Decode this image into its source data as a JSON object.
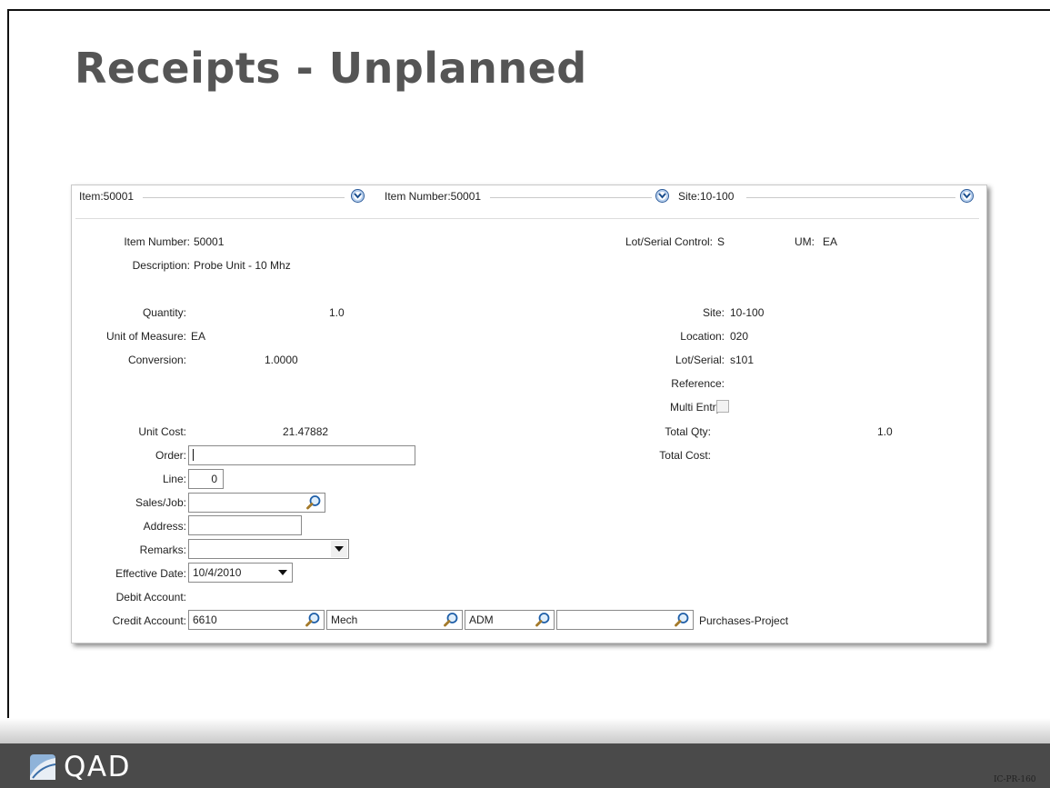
{
  "slide": {
    "title": "Receipts - Unplanned",
    "code": "IC-PR-160"
  },
  "header": {
    "item": "Item:50001",
    "item_number": "Item Number:50001",
    "site": "Site:10-100"
  },
  "form": {
    "item_number_label": "Item Number:",
    "item_number_value": "50001",
    "description_label": "Description:",
    "description_value": "Probe Unit - 10 Mhz",
    "lot_serial_control_label": "Lot/Serial Control:",
    "lot_serial_control_value": "S",
    "um_label": "UM:",
    "um_value": "EA",
    "quantity_label": "Quantity:",
    "quantity_value": "1.0",
    "uom_label": "Unit of Measure:",
    "uom_value": "EA",
    "conversion_label": "Conversion:",
    "conversion_value": "1.0000",
    "site_label": "Site:",
    "site_value": "10-100",
    "location_label": "Location:",
    "location_value": "020",
    "lot_serial_label": "Lot/Serial:",
    "lot_serial_value": "s101",
    "reference_label": "Reference:",
    "multi_entry_label": "Multi Entry:",
    "multi_entry_checked": false,
    "unit_cost_label": "Unit Cost:",
    "unit_cost_value": "21.47882",
    "total_qty_label": "Total Qty:",
    "total_qty_value": "1.0",
    "total_cost_label": "Total Cost:",
    "order_label": "Order:",
    "order_value": "",
    "line_label": "Line:",
    "line_value": "0",
    "sales_job_label": "Sales/Job:",
    "sales_job_value": "",
    "address_label": "Address:",
    "address_value": "",
    "remarks_label": "Remarks:",
    "remarks_value": "",
    "effective_date_label": "Effective Date:",
    "effective_date_value": "10/4/2010",
    "debit_account_label": "Debit Account:",
    "credit_account_label": "Credit Account:",
    "credit_account_value": "6610",
    "credit_sub_value": "Mech",
    "credit_cc_value": "ADM",
    "credit_project_value": "",
    "credit_desc": "Purchases-Project"
  },
  "footer": {
    "logo_text": "QAD"
  },
  "colors": {
    "title": "#555555",
    "footer": "#4a4a4a",
    "accent": "#2a5a9a"
  },
  "icons": [
    "chevron-down-circle-icon",
    "magnifier-icon",
    "dropdown-arrow-icon",
    "qad-logo-icon"
  ]
}
